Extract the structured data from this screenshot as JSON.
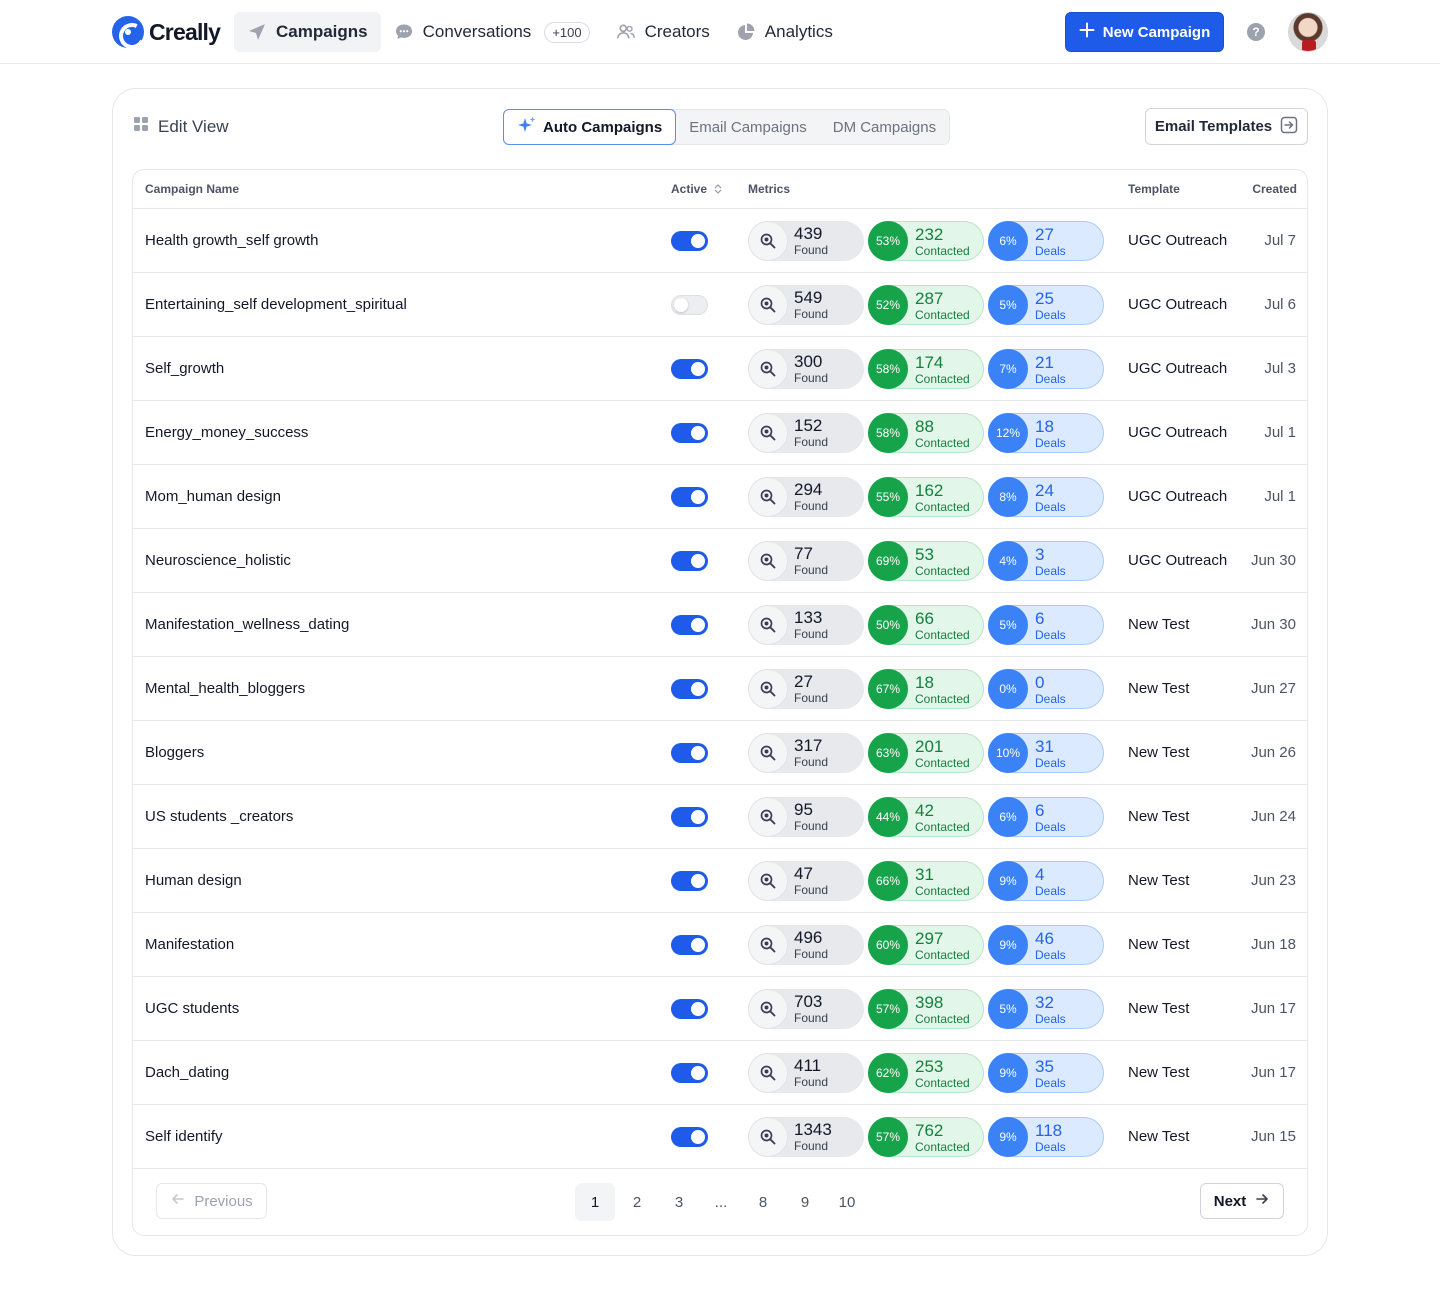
{
  "brand": {
    "name": "Creally",
    "accent": "#1d5be8"
  },
  "nav": {
    "campaigns": "Campaigns",
    "conversations": "Conversations",
    "conversations_badge": "+100",
    "creators": "Creators",
    "analytics": "Analytics"
  },
  "actions": {
    "new_campaign": "New Campaign",
    "help": "?"
  },
  "card": {
    "edit_view": "Edit View",
    "tabs": {
      "auto": "Auto Campaigns",
      "email": "Email Campaigns",
      "dm": "DM Campaigns"
    },
    "email_templates": "Email Templates"
  },
  "table": {
    "headers": {
      "name": "Campaign Name",
      "active": "Active",
      "metrics": "Metrics",
      "template": "Template",
      "created": "Created"
    },
    "rows": [
      {
        "name": "Health growth_self growth",
        "active": true,
        "found": "439",
        "found_label": "Found",
        "contacted_pct": "53%",
        "contacted": "232",
        "contacted_label": "Contacted",
        "deals_pct": "6%",
        "deals": "27",
        "deals_label": "Deals",
        "template": "UGC Outreach",
        "created": "Jul 7"
      },
      {
        "name": "Entertaining_self development_spiritual",
        "active": false,
        "found": "549",
        "found_label": "Found",
        "contacted_pct": "52%",
        "contacted": "287",
        "contacted_label": "Contacted",
        "deals_pct": "5%",
        "deals": "25",
        "deals_label": "Deals",
        "template": "UGC Outreach",
        "created": "Jul 6"
      },
      {
        "name": "Self_growth",
        "active": true,
        "found": "300",
        "found_label": "Found",
        "contacted_pct": "58%",
        "contacted": "174",
        "contacted_label": "Contacted",
        "deals_pct": "7%",
        "deals": "21",
        "deals_label": "Deals",
        "template": "UGC Outreach",
        "created": "Jul 3"
      },
      {
        "name": "Energy_money_success",
        "active": true,
        "found": "152",
        "found_label": "Found",
        "contacted_pct": "58%",
        "contacted": "88",
        "contacted_label": "Contacted",
        "deals_pct": "12%",
        "deals": "18",
        "deals_label": "Deals",
        "template": "UGC Outreach",
        "created": "Jul 1"
      },
      {
        "name": "Mom_human design",
        "active": true,
        "found": "294",
        "found_label": "Found",
        "contacted_pct": "55%",
        "contacted": "162",
        "contacted_label": "Contacted",
        "deals_pct": "8%",
        "deals": "24",
        "deals_label": "Deals",
        "template": "UGC Outreach",
        "created": "Jul 1"
      },
      {
        "name": "Neuroscience_holistic",
        "active": true,
        "found": "77",
        "found_label": "Found",
        "contacted_pct": "69%",
        "contacted": "53",
        "contacted_label": "Contacted",
        "deals_pct": "4%",
        "deals": "3",
        "deals_label": "Deals",
        "template": "UGC Outreach",
        "created": "Jun 30"
      },
      {
        "name": "Manifestation_wellness_dating",
        "active": true,
        "found": "133",
        "found_label": "Found",
        "contacted_pct": "50%",
        "contacted": "66",
        "contacted_label": "Contacted",
        "deals_pct": "5%",
        "deals": "6",
        "deals_label": "Deals",
        "template": "New Test",
        "created": "Jun 30"
      },
      {
        "name": "Mental_health_bloggers",
        "active": true,
        "found": "27",
        "found_label": "Found",
        "contacted_pct": "67%",
        "contacted": "18",
        "contacted_label": "Contacted",
        "deals_pct": "0%",
        "deals": "0",
        "deals_label": "Deals",
        "template": "New Test",
        "created": "Jun 27"
      },
      {
        "name": "Bloggers",
        "active": true,
        "found": "317",
        "found_label": "Found",
        "contacted_pct": "63%",
        "contacted": "201",
        "contacted_label": "Contacted",
        "deals_pct": "10%",
        "deals": "31",
        "deals_label": "Deals",
        "template": "New Test",
        "created": "Jun 26"
      },
      {
        "name": "US students _creators",
        "active": true,
        "found": "95",
        "found_label": "Found",
        "contacted_pct": "44%",
        "contacted": "42",
        "contacted_label": "Contacted",
        "deals_pct": "6%",
        "deals": "6",
        "deals_label": "Deals",
        "template": "New Test",
        "created": "Jun 24"
      },
      {
        "name": "Human design",
        "active": true,
        "found": "47",
        "found_label": "Found",
        "contacted_pct": "66%",
        "contacted": "31",
        "contacted_label": "Contacted",
        "deals_pct": "9%",
        "deals": "4",
        "deals_label": "Deals",
        "template": "New Test",
        "created": "Jun 23"
      },
      {
        "name": "Manifestation",
        "active": true,
        "found": "496",
        "found_label": "Found",
        "contacted_pct": "60%",
        "contacted": "297",
        "contacted_label": "Contacted",
        "deals_pct": "9%",
        "deals": "46",
        "deals_label": "Deals",
        "template": "New Test",
        "created": "Jun 18"
      },
      {
        "name": "UGC students",
        "active": true,
        "found": "703",
        "found_label": "Found",
        "contacted_pct": "57%",
        "contacted": "398",
        "contacted_label": "Contacted",
        "deals_pct": "5%",
        "deals": "32",
        "deals_label": "Deals",
        "template": "New Test",
        "created": "Jun 17"
      },
      {
        "name": "Dach_dating",
        "active": true,
        "found": "411",
        "found_label": "Found",
        "contacted_pct": "62%",
        "contacted": "253",
        "contacted_label": "Contacted",
        "deals_pct": "9%",
        "deals": "35",
        "deals_label": "Deals",
        "template": "New Test",
        "created": "Jun 17"
      },
      {
        "name": "Self identify",
        "active": true,
        "found": "1343",
        "found_label": "Found",
        "contacted_pct": "57%",
        "contacted": "762",
        "contacted_label": "Contacted",
        "deals_pct": "9%",
        "deals": "118",
        "deals_label": "Deals",
        "template": "New Test",
        "created": "Jun 15"
      }
    ]
  },
  "pagination": {
    "previous": "Previous",
    "next": "Next",
    "pages": [
      "1",
      "2",
      "3",
      "...",
      "8",
      "9",
      "10"
    ],
    "current": "1"
  },
  "colors": {
    "primary": "#1d5be8",
    "contacted": "#16a34a",
    "deals": "#3b82f6"
  },
  "icons": {
    "nav": [
      "send-icon",
      "chat-bubble-icon",
      "users-icon",
      "pie-chart-icon"
    ],
    "toolbar": [
      "plus-icon",
      "help-icon",
      "grid-icon",
      "sparkle-icon",
      "arrow-right-box-icon"
    ],
    "row": [
      "magnifier-icon"
    ],
    "pager": [
      "arrow-left-icon",
      "arrow-right-icon"
    ]
  }
}
